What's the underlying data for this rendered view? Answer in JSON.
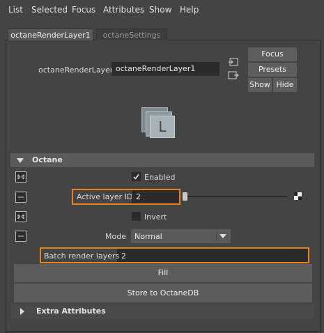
{
  "menu": [
    "List",
    "Selected",
    "Focus",
    "Attributes",
    "Show",
    "Help"
  ],
  "tabs": [
    "octaneRenderLayer1",
    "octaneSettings"
  ],
  "node": {
    "label": "octaneRenderLayer:",
    "value": "octaneRenderLayer1"
  },
  "buttons": {
    "focus": "Focus",
    "presets": "Presets",
    "show": "Show",
    "hide": "Hide"
  },
  "icon_letter": "L",
  "octane_section": {
    "title": "Octane",
    "enabled_label": "Enabled",
    "enabled_checked": true,
    "active_layer_label": "Active layer ID",
    "active_layer_value": "2",
    "invert_label": "Invert",
    "mode_label": "Mode",
    "mode_value": "Normal",
    "batch_label": "Batch render layers",
    "batch_value": "2"
  },
  "actions": {
    "fill": "Fill",
    "store": "Store to OctaneDB"
  },
  "extra_section": {
    "title": "Extra Attributes"
  },
  "colors": {
    "highlight": "#e8821c",
    "background": "#444444",
    "field": "#2b2b2b"
  }
}
